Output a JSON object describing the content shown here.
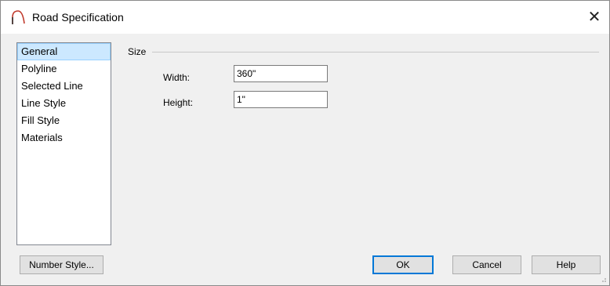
{
  "window": {
    "title": "Road Specification",
    "close_glyph": "✕"
  },
  "nav": {
    "items": [
      {
        "label": "General",
        "selected": true
      },
      {
        "label": "Polyline"
      },
      {
        "label": "Selected Line"
      },
      {
        "label": "Line Style"
      },
      {
        "label": "Fill Style"
      },
      {
        "label": "Materials"
      }
    ]
  },
  "size_group": {
    "label": "Size",
    "width": {
      "label": "Width:",
      "value": "360\""
    },
    "height": {
      "label": "Height:",
      "value": "1\""
    }
  },
  "buttons": {
    "number_style": "Number Style...",
    "ok": "OK",
    "cancel": "Cancel",
    "help": "Help"
  },
  "colors": {
    "selection": "#cce8ff",
    "default_button_border": "#0078d7"
  }
}
